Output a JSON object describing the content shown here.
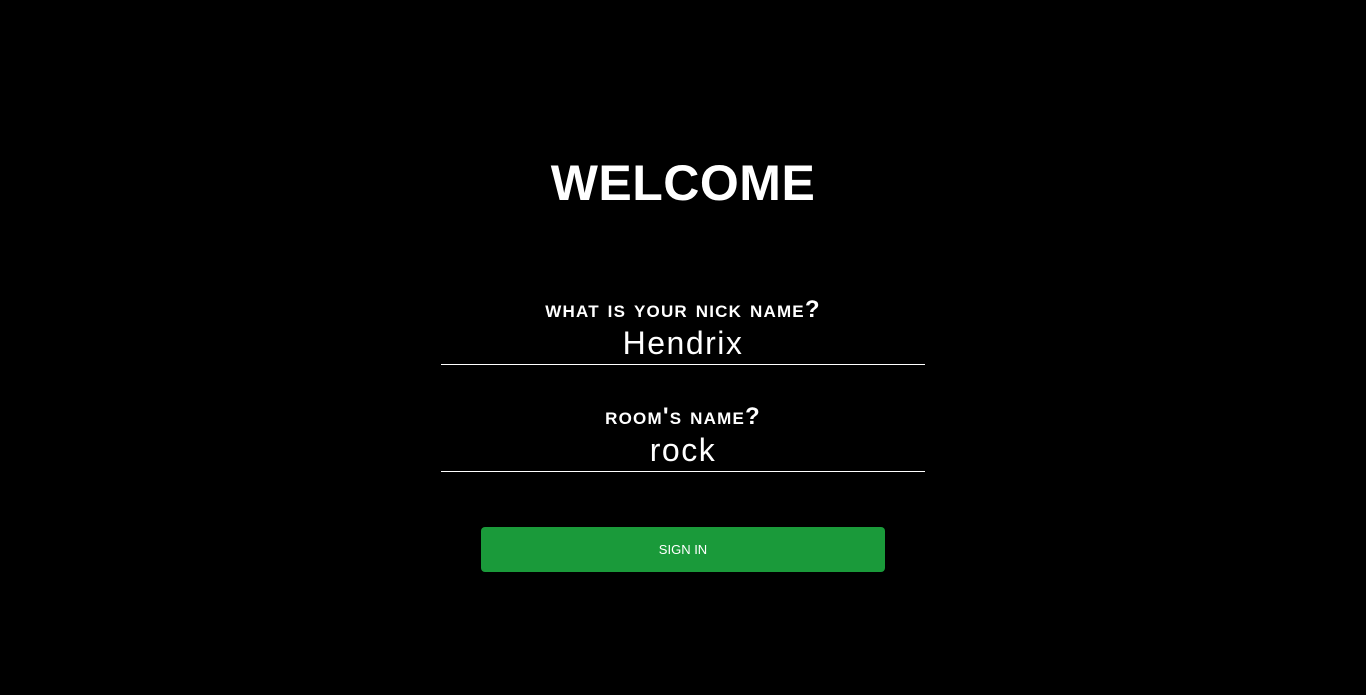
{
  "page": {
    "title": "WELCOME"
  },
  "form": {
    "nick": {
      "label": "What is your nick name?",
      "value": "Hendrix"
    },
    "room": {
      "label": "Room's name?",
      "value": "rock"
    },
    "submit_label": "SIGN IN"
  },
  "colors": {
    "background": "#000000",
    "text": "#ffffff",
    "button": "#1a9a3a"
  }
}
